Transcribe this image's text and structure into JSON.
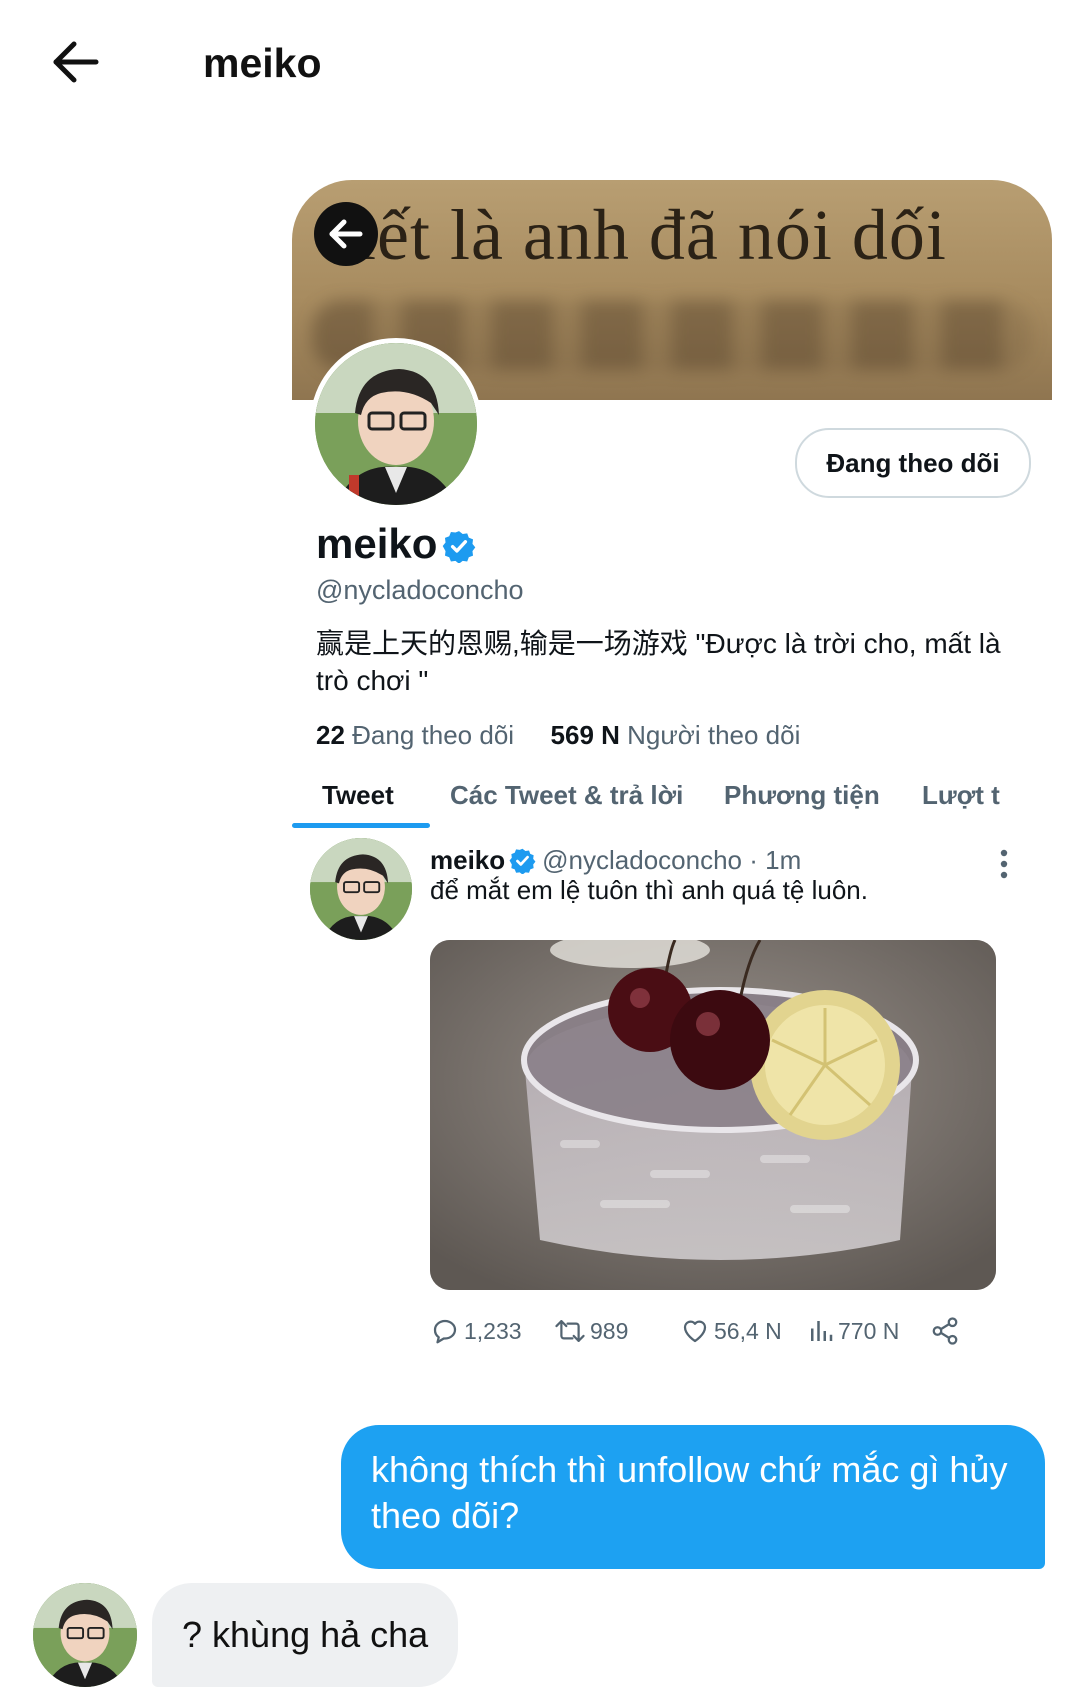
{
  "chat": {
    "title": "meiko"
  },
  "card": {
    "banner_text": "iết là anh đã nói dối",
    "follow_button": "Đang theo dõi",
    "name": "meiko",
    "handle": "@nycladoconcho",
    "bio": "赢是上天的恩赐,输是一场游戏 \"Được là trời cho, mất là trò chơi \"",
    "stats": {
      "following_count": "22",
      "following_label": "Đang theo dõi",
      "followers_count": "569 N",
      "followers_label": "Người theo dõi"
    },
    "tabs": [
      "Tweet",
      "Các Tweet & trả lời",
      "Phương tiện",
      "Lượt t"
    ],
    "tweet": {
      "name": "meiko",
      "handle_time": "@nycladoconcho · 1m",
      "text": "để mắt em lệ tuôn thì anh quá tệ luôn.",
      "replies": "1,233",
      "retweets": "989",
      "likes": "56,4 N",
      "views": "770 N"
    }
  },
  "messages": {
    "sent": "không thích thì unfollow chứ mắc gì hủy theo dõi?",
    "received": "? khùng hả cha"
  },
  "colors": {
    "accent_blue": "#1d9bf0",
    "sent_bubble": "#1da1f2",
    "received_bubble": "#eef0f2"
  }
}
